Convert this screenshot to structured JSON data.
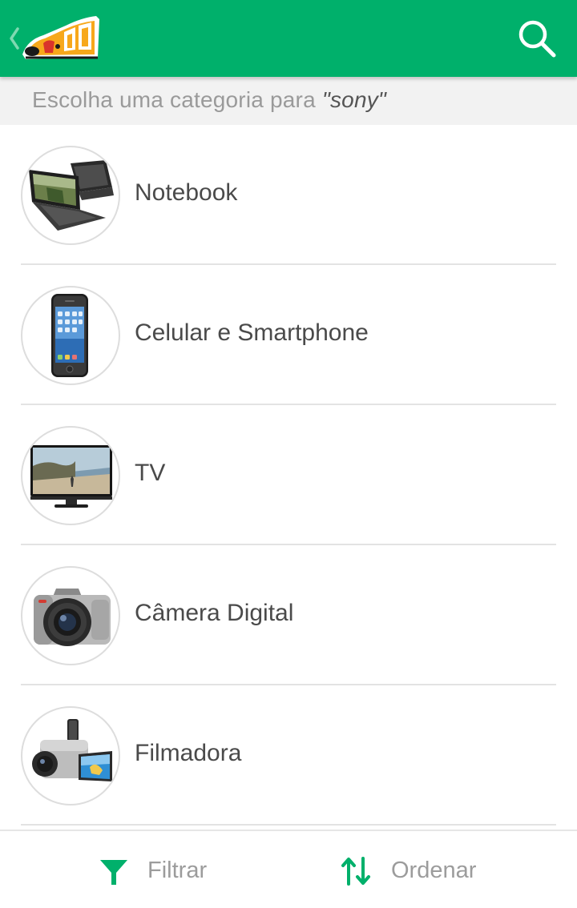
{
  "colors": {
    "brand_green": "#00b06b",
    "subheader_bg": "#f2f2f2",
    "label_text": "#4a4a4a",
    "muted_text": "#9a9a9a",
    "divider": "#e3e3e3"
  },
  "topbar": {
    "back_icon": "chevron-left-icon",
    "logo_icon": "dog-logo-icon",
    "search_icon": "search-icon"
  },
  "subheader": {
    "prefix": "Escolha uma categoria para ",
    "query": "\"sony\""
  },
  "categories": [
    {
      "label": "Notebook",
      "icon": "notebook-thumbnail"
    },
    {
      "label": "Celular e Smartphone",
      "icon": "smartphone-thumbnail"
    },
    {
      "label": "TV",
      "icon": "tv-thumbnail"
    },
    {
      "label": "Câmera Digital",
      "icon": "camera-thumbnail"
    },
    {
      "label": "Filmadora",
      "icon": "camcorder-thumbnail"
    }
  ],
  "bottombar": {
    "filter_label": "Filtrar",
    "filter_icon": "funnel-icon",
    "sort_label": "Ordenar",
    "sort_icon": "sort-arrows-icon"
  }
}
